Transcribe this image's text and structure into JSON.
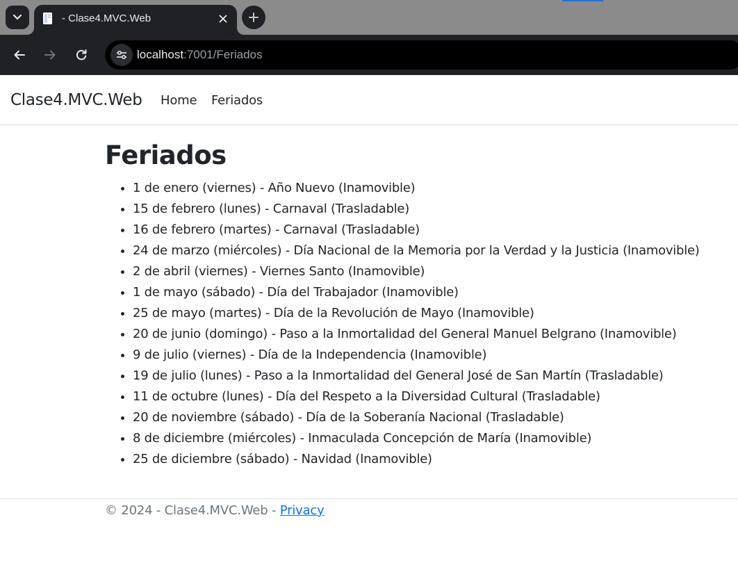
{
  "browser": {
    "tab": {
      "title": "- Clase4.MVC.Web"
    },
    "address": {
      "host": "localhost",
      "rest": ":7001/Feriados"
    },
    "icons": [
      "tab-list-icon",
      "favicon-icon",
      "close-icon",
      "plus-icon",
      "back-icon",
      "forward-icon",
      "reload-icon",
      "site-info-icon"
    ]
  },
  "navbar": {
    "brand": "Clase4.MVC.Web",
    "links": [
      "Home",
      "Feriados"
    ]
  },
  "main": {
    "title": "Feriados",
    "holidays": [
      "1 de enero (viernes) - Año Nuevo (Inamovible)",
      "15 de febrero (lunes) - Carnaval (Trasladable)",
      "16 de febrero (martes) - Carnaval (Trasladable)",
      "24 de marzo (miércoles) - Día Nacional de la Memoria por la Verdad y la Justicia (Inamovible)",
      "2 de abril (viernes) - Viernes Santo (Inamovible)",
      "1 de mayo (sábado) - Día del Trabajador (Inamovible)",
      "25 de mayo (martes) - Día de la Revolución de Mayo (Inamovible)",
      "20 de junio (domingo) - Paso a la Inmortalidad del General Manuel Belgrano (Inamovible)",
      "9 de julio (viernes) - Día de la Independencia (Inamovible)",
      "19 de julio (lunes) - Paso a la Inmortalidad del General José de San Martín (Trasladable)",
      "11 de octubre (lunes) - Día del Respeto a la Diversidad Cultural (Trasladable)",
      "20 de noviembre (sábado) - Día de la Soberanía Nacional (Trasladable)",
      "8 de diciembre (miércoles) - Inmaculada Concepción de María (Inamovible)",
      "25 de diciembre (sábado) - Navidad (Inamovible)"
    ]
  },
  "footer": {
    "text": "© 2024 - Clase4.MVC.Web - ",
    "link": "Privacy"
  },
  "colors": {
    "chrome_dark": "#202124",
    "tabstrip": "#8b8b8b",
    "text": "#212529",
    "muted": "#6c757d",
    "link": "#0d6efd"
  }
}
